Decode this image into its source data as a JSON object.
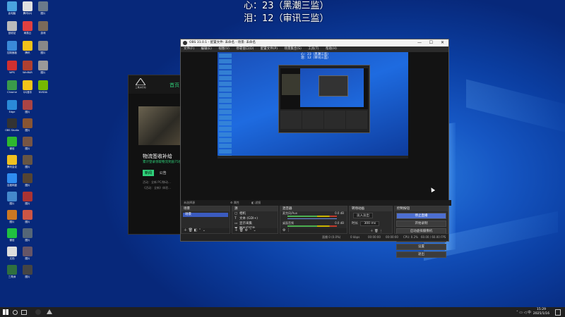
{
  "overlay": {
    "line1": "心：23（黑潮三监）",
    "line2": "泪：12（审讯三监）"
  },
  "desktop_icons": [
    {
      "label": "此电脑",
      "color": "#4aa3df"
    },
    {
      "label": "腾讯QQ",
      "color": "#e0e0e0"
    },
    {
      "label": "图片",
      "color": "#6a7a8a"
    },
    {
      "label": "回收站",
      "color": "#bbbbbb"
    },
    {
      "label": "网易云",
      "color": "#e04040"
    },
    {
      "label": "游戏",
      "color": "#7a6a5a"
    },
    {
      "label": "控制面板",
      "color": "#3a8ad8"
    },
    {
      "label": "腾讯",
      "color": "#f2c21a"
    },
    {
      "label": "图片",
      "color": "#888"
    },
    {
      "label": "WPS",
      "color": "#d03030"
    },
    {
      "label": "WinRAR",
      "color": "#b04030"
    },
    {
      "label": "图片",
      "color": "#999"
    },
    {
      "label": "Chrome",
      "color": "#3a9a4a"
    },
    {
      "label": "QQ音乐",
      "color": "#f5c518"
    },
    {
      "label": "NVIDIA",
      "color": "#76b900"
    },
    {
      "label": "Edge",
      "color": "#2a8ad8"
    },
    {
      "label": "图片",
      "color": "#aa4444"
    },
    {
      "label": "OBS Studio",
      "color": "#333333"
    },
    {
      "label": "图片",
      "color": "#885533"
    },
    {
      "label": "微信",
      "color": "#2eb82e"
    },
    {
      "label": "图片",
      "color": "#775544"
    },
    {
      "label": "腾讯会议",
      "color": "#f0c020"
    },
    {
      "label": "图片",
      "color": "#665544"
    },
    {
      "label": "百度网盘",
      "color": "#2f8cf0"
    },
    {
      "label": "图片",
      "color": "#554433"
    },
    {
      "label": "图片",
      "color": "#4488cc"
    },
    {
      "label": "图片",
      "color": "#aa3333"
    },
    {
      "label": "图片",
      "color": "#cc7722"
    },
    {
      "label": "图片",
      "color": "#cc5544"
    },
    {
      "label": "微信",
      "color": "#20c040"
    },
    {
      "label": "图片",
      "color": "#556677"
    },
    {
      "label": "文档",
      "color": "#dddddd"
    },
    {
      "label": "图片",
      "color": "#665566"
    },
    {
      "label": "三角洲",
      "color": "#2f6f3f"
    },
    {
      "label": "图片",
      "color": "#444"
    }
  ],
  "website": {
    "logo_text": "三角洲行动",
    "nav": "首页",
    "title": "物流签收补给",
    "subtitle": "累计登录领取物流奖励75份",
    "tabs": [
      "新闻",
      "公告"
    ],
    "lines": [
      "活动：全新 PC/移动…",
      "《活动：全新》体验…"
    ]
  },
  "obs": {
    "title": "OBS 31.0.1 - 配置文件: 未命名 - 场景: 未命名",
    "menu": [
      "文件(F)",
      "编辑(E)",
      "视图(V)",
      "停靠窗口(D)",
      "配置文件(P)",
      "场景集合(S)",
      "工具(T)",
      "帮助(H)"
    ],
    "status_strip": "未选择源",
    "scenes_label": "场景",
    "scene_item": "场景",
    "sources_label": "源",
    "sources": [
      "相机",
      "文本 (GDI+)",
      "显示采集",
      "图片幻灯片"
    ],
    "mixer_label": "混音器",
    "mixer_tracks": [
      {
        "name": "麦克风/Aux",
        "db": "0.0 dB"
      },
      {
        "name": "桌面音频",
        "db": "0.0 dB"
      }
    ],
    "transition_label": "转场动画",
    "transition_type": "淡入淡出",
    "duration_label": "时长",
    "duration": "300 ms",
    "controls_label": "控制按钮",
    "controls": [
      "停止直播",
      "开始录制",
      "启动虚拟摄像机",
      "工作室模式",
      "设置",
      "退出"
    ],
    "footer": [
      "直播 0 (0.0%)",
      "0 kbps",
      "00:00:00",
      "00:00:00",
      "CPU: 0.2%",
      "60.00 / 60.00 FPS"
    ],
    "preview_overlay": [
      "心：23（黑潮三监）",
      "泪：12（审讯三监）"
    ]
  },
  "taskbar": {
    "time": "15:29",
    "date": "2025/1/16"
  }
}
